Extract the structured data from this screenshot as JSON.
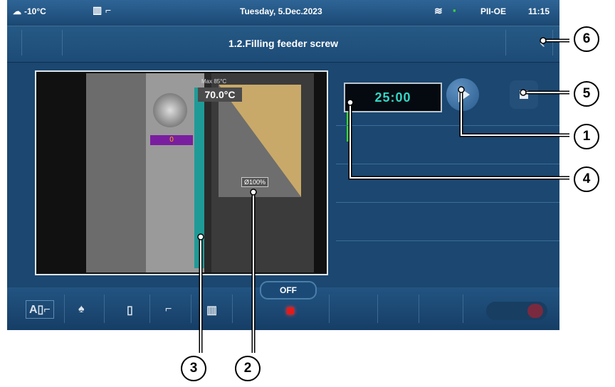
{
  "status": {
    "weather_temp": "-10°C",
    "date": "Tuesday, 5.Dec.2023",
    "mode": "PII-OE",
    "time": "11:15"
  },
  "header": {
    "title": "1.2.Filling feeder screw"
  },
  "diagram": {
    "max_label": "Max 85°C",
    "temperature": "70.0°C",
    "level_value": "0",
    "sensor_label": "Ø100%"
  },
  "controls": {
    "timer": "25:00"
  },
  "bottom": {
    "off_label": "OFF"
  },
  "callouts": [
    "1",
    "2",
    "3",
    "4",
    "5",
    "6"
  ]
}
